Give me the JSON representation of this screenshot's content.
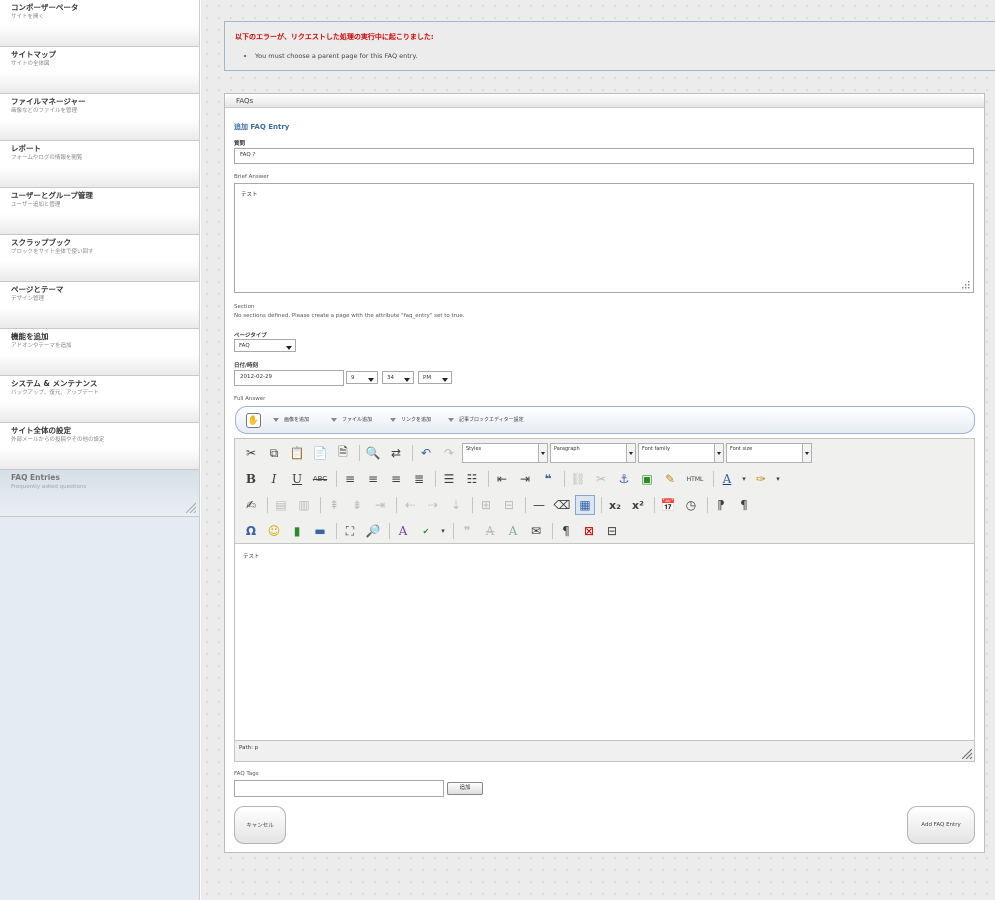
{
  "sidebar": {
    "items": [
      {
        "title": "コンポーザーペータ",
        "subtitle": "サイトを開く"
      },
      {
        "title": "サイトマップ",
        "subtitle": "サイトの全体図"
      },
      {
        "title": "ファイルマネージャー",
        "subtitle": "画像などのファイルを管理"
      },
      {
        "title": "レポート",
        "subtitle": "フォームやログの情報を閲覧"
      },
      {
        "title": "ユーザーとグループ管理",
        "subtitle": "ユーザー追加と管理"
      },
      {
        "title": "スクラップブック",
        "subtitle": "ブロックをサイト全体で使い回す"
      },
      {
        "title": "ページとテーマ",
        "subtitle": "デザイン管理"
      },
      {
        "title": "機能を追加",
        "subtitle": "アドオンやテーマを追加"
      },
      {
        "title": "システム & メンテナンス",
        "subtitle": "バックアップ、復元、アップデート"
      },
      {
        "title": "サイト全体の設定",
        "subtitle": "外部メールからの投稿やその他の設定"
      },
      {
        "title": "FAQ Entries",
        "subtitle": "Frequently asked questions"
      }
    ]
  },
  "error": {
    "heading": "以下のエラーが、リクエストした処理の実行中に起こりました:",
    "messages": [
      "You must choose a parent page for this FAQ entry."
    ]
  },
  "panel": {
    "title": "FAQs",
    "section_title": "追加 FAQ Entry",
    "question_label": "質問",
    "question_value": "FAQ ?",
    "brief_label": "Brief Answer",
    "brief_value": "テスト",
    "section_label": "Section",
    "section_note": "No sections defined. Please create a page with the attribute \"faq_entry\" set to true.",
    "page_type_label": "ページタイプ",
    "page_type_value": "FAQ",
    "datetime_label": "日付/時刻",
    "date_value": "2012-02-29",
    "hour_value": "9",
    "minute_value": "34",
    "ampm_value": "PM",
    "full_answer_label": "Full Answer",
    "tags_label": "FAQ Tags",
    "tags_value": "",
    "add_tag_label": "追加",
    "cancel_label": "キャンセル",
    "submit_label": "Add FAQ Entry"
  },
  "editor": {
    "logo": "✋",
    "top_menus": [
      "画像を追加",
      "ファイル追加",
      "リンクを追加",
      "記事ブロックエディター設定"
    ],
    "styles_select": "Styles",
    "format_select": "Paragraph",
    "font_family_select": "Font family",
    "font_size_select": "Font size",
    "html_button": "HTML",
    "body_text": "テスト",
    "path_text": "Path: p"
  }
}
